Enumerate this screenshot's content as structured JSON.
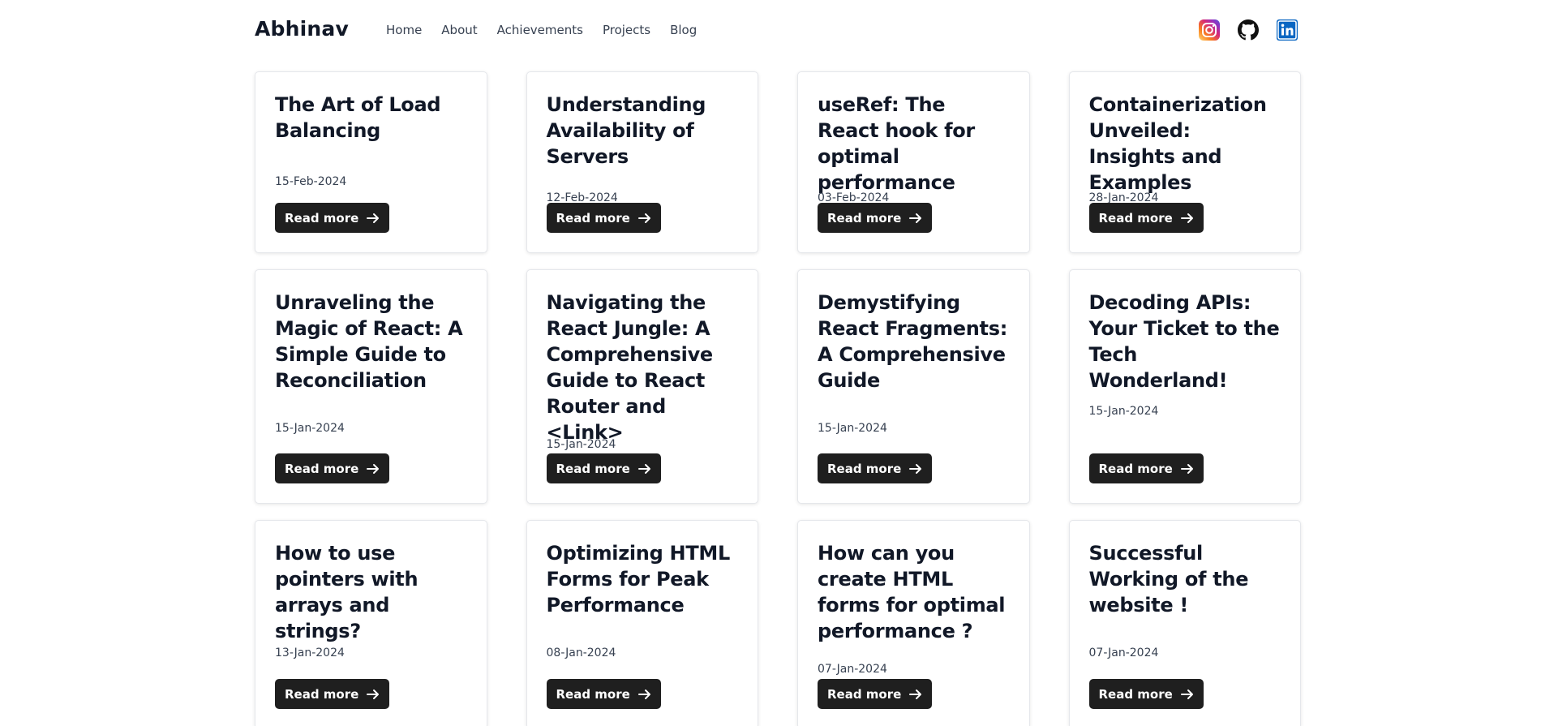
{
  "brand": "Abhinav",
  "nav": {
    "items": [
      {
        "label": "Home"
      },
      {
        "label": "About"
      },
      {
        "label": "Achievements"
      },
      {
        "label": "Projects"
      },
      {
        "label": "Blog"
      }
    ]
  },
  "socials": [
    {
      "icon": "instagram-icon"
    },
    {
      "icon": "github-icon"
    },
    {
      "icon": "linkedin-icon"
    }
  ],
  "colors": {
    "button_bg": "#1f1f1f",
    "instagram_gradient": [
      "#feda75",
      "#fa7e1e",
      "#d62976",
      "#962fbf",
      "#4f5bd5"
    ],
    "linkedin_blue": "#0a66c2",
    "github_black": "#111111"
  },
  "read_more_label": "Read more",
  "posts": [
    {
      "title": "The Art of Load Balancing",
      "date": "15-Feb-2024"
    },
    {
      "title": "Understanding Availability of Servers",
      "date": "12-Feb-2024"
    },
    {
      "title": "useRef: The React hook for optimal performance",
      "date": "03-Feb-2024"
    },
    {
      "title": "Containerization Unveiled: Insights and Examples",
      "date": "28-Jan-2024"
    },
    {
      "title": "Unraveling the Magic of React: A Simple Guide to Reconciliation",
      "date": "15-Jan-2024"
    },
    {
      "title": "Navigating the React Jungle: A Comprehensive Guide to React Router and <Link>",
      "date": "15-Jan-2024"
    },
    {
      "title": "Demystifying React Fragments: A Comprehensive Guide",
      "date": "15-Jan-2024"
    },
    {
      "title": "Decoding APIs: Your Ticket to the Tech Wonderland!",
      "date": "15-Jan-2024"
    },
    {
      "title": "How to use pointers with arrays and strings?",
      "date": "13-Jan-2024"
    },
    {
      "title": "Optimizing HTML Forms for Peak Performance",
      "date": "08-Jan-2024"
    },
    {
      "title": "How can you create HTML forms for optimal performance ?",
      "date": "07-Jan-2024"
    },
    {
      "title": "Successful Working of the website !",
      "date": "07-Jan-2024"
    }
  ]
}
